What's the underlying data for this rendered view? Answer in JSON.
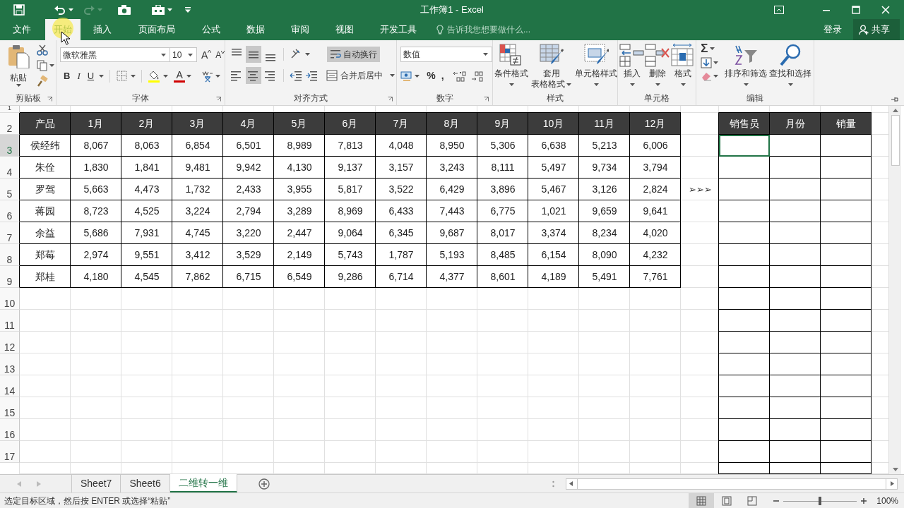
{
  "title_bar": {
    "title": "工作簿1 - Excel"
  },
  "menu_tabs": [
    {
      "label": "文件",
      "selected": false
    },
    {
      "label": "开始",
      "selected": true
    },
    {
      "label": "插入",
      "selected": false
    },
    {
      "label": "页面布局",
      "selected": false
    },
    {
      "label": "公式",
      "selected": false
    },
    {
      "label": "数据",
      "selected": false
    },
    {
      "label": "审阅",
      "selected": false
    },
    {
      "label": "视图",
      "selected": false
    },
    {
      "label": "开发工具",
      "selected": false
    }
  ],
  "tell_me": {
    "placeholder": "告诉我您想要做什么..."
  },
  "account": {
    "sign_in": "登录",
    "share": "共享"
  },
  "ribbon": {
    "clipboard": {
      "label": "剪贴板",
      "paste": "粘贴"
    },
    "font": {
      "label": "字体",
      "font_name": "微软雅黑",
      "font_size": "10",
      "grow": "A",
      "shrink": "A",
      "styles": [
        "B",
        "I",
        "U"
      ],
      "font_color": "A"
    },
    "alignment": {
      "label": "对齐方式",
      "vertical": [
        {
          "selected": false
        },
        {
          "selected": true
        },
        {
          "selected": false
        }
      ],
      "horizontal": [
        {
          "selected": false
        },
        {
          "selected": true
        },
        {
          "selected": false
        }
      ],
      "wrap_text": {
        "label": "自动换行",
        "selected": true
      },
      "merge": "合并后居中"
    },
    "number": {
      "label": "数字",
      "format": "数值",
      "symbols": [
        "%",
        ","
      ]
    },
    "styles": {
      "label": "样式",
      "buttons": [
        {
          "kind": "conditional",
          "lines": [
            "条件格式"
          ]
        },
        {
          "kind": "table",
          "lines": [
            "套用",
            "表格格式"
          ]
        },
        {
          "kind": "cell",
          "lines": [
            "单元格样式"
          ]
        }
      ]
    },
    "cells": {
      "label": "单元格",
      "buttons": [
        {
          "kind": "insert",
          "lines": [
            "插入"
          ]
        },
        {
          "kind": "delete",
          "lines": [
            "删除"
          ]
        },
        {
          "kind": "format",
          "lines": [
            "格式"
          ]
        }
      ]
    },
    "editing": {
      "label": "编辑",
      "autosum": "Σ",
      "buttons": [
        {
          "kind": "sort",
          "lines": [
            "排序和筛选"
          ]
        },
        {
          "kind": "find",
          "lines": [
            "查找和选择"
          ]
        }
      ]
    }
  },
  "sheet": {
    "row_headers": [
      {
        "label": "1",
        "selected": false
      },
      {
        "label": "2",
        "selected": false
      },
      {
        "label": "3",
        "selected": true
      },
      {
        "label": "4",
        "selected": false
      },
      {
        "label": "5",
        "selected": false
      },
      {
        "label": "6",
        "selected": false
      },
      {
        "label": "7",
        "selected": false
      },
      {
        "label": "8",
        "selected": false
      },
      {
        "label": "9",
        "selected": false
      },
      {
        "label": "10",
        "selected": false
      },
      {
        "label": "11",
        "selected": false
      },
      {
        "label": "12",
        "selected": false
      },
      {
        "label": "13",
        "selected": false
      },
      {
        "label": "14",
        "selected": false
      },
      {
        "label": "15",
        "selected": false
      },
      {
        "label": "16",
        "selected": false
      },
      {
        "label": "17",
        "selected": false
      }
    ],
    "data_table": {
      "columns": [
        "产品",
        "1月",
        "2月",
        "3月",
        "4月",
        "5月",
        "6月",
        "7月",
        "8月",
        "9月",
        "10月",
        "11月",
        "12月"
      ],
      "rows": [
        [
          "侯经纬",
          "8,067",
          "8,063",
          "6,854",
          "6,501",
          "8,989",
          "7,813",
          "4,048",
          "8,950",
          "5,306",
          "6,638",
          "5,213",
          "6,006"
        ],
        [
          "朱佺",
          "1,830",
          "1,841",
          "9,481",
          "9,942",
          "4,130",
          "9,137",
          "3,157",
          "3,243",
          "8,111",
          "5,497",
          "9,734",
          "3,794"
        ],
        [
          "罗驾",
          "5,663",
          "4,473",
          "1,732",
          "2,433",
          "3,955",
          "5,817",
          "3,522",
          "6,429",
          "3,896",
          "5,467",
          "3,126",
          "2,824"
        ],
        [
          "蒋园",
          "8,723",
          "4,525",
          "3,224",
          "2,794",
          "3,289",
          "8,969",
          "6,433",
          "7,443",
          "6,775",
          "1,021",
          "9,659",
          "9,641"
        ],
        [
          "余益",
          "5,686",
          "7,931",
          "4,745",
          "3,220",
          "2,447",
          "9,064",
          "6,345",
          "9,687",
          "8,017",
          "3,374",
          "8,234",
          "4,020"
        ],
        [
          "郑莓",
          "2,974",
          "9,551",
          "3,412",
          "3,529",
          "2,149",
          "5,743",
          "1,787",
          "5,193",
          "8,485",
          "6,154",
          "8,090",
          "4,232"
        ],
        [
          "郑桂",
          "4,180",
          "4,545",
          "7,862",
          "6,715",
          "6,549",
          "9,286",
          "6,714",
          "4,377",
          "8,601",
          "4,189",
          "5,491",
          "7,761"
        ]
      ]
    },
    "arrow_marker": "➢➢➢",
    "output_table": {
      "columns": [
        "销售员",
        "月份",
        "销量"
      ],
      "rows": [
        [
          {
            "selected": true
          },
          {
            "selected": false
          },
          {
            "selected": false
          }
        ],
        [
          {
            "selected": false
          },
          {
            "selected": false
          },
          {
            "selected": false
          }
        ],
        [
          {
            "selected": false
          },
          {
            "selected": false
          },
          {
            "selected": false
          }
        ],
        [
          {
            "selected": false
          },
          {
            "selected": false
          },
          {
            "selected": false
          }
        ],
        [
          {
            "selected": false
          },
          {
            "selected": false
          },
          {
            "selected": false
          }
        ],
        [
          {
            "selected": false
          },
          {
            "selected": false
          },
          {
            "selected": false
          }
        ],
        [
          {
            "selected": false
          },
          {
            "selected": false
          },
          {
            "selected": false
          }
        ],
        [
          {
            "selected": false
          },
          {
            "selected": false
          },
          {
            "selected": false
          }
        ],
        [
          {
            "selected": false
          },
          {
            "selected": false
          },
          {
            "selected": false
          }
        ],
        [
          {
            "selected": false
          },
          {
            "selected": false
          },
          {
            "selected": false
          }
        ],
        [
          {
            "selected": false
          },
          {
            "selected": false
          },
          {
            "selected": false
          }
        ],
        [
          {
            "selected": false
          },
          {
            "selected": false
          },
          {
            "selected": false
          }
        ],
        [
          {
            "selected": false
          },
          {
            "selected": false
          },
          {
            "selected": false
          }
        ],
        [
          {
            "selected": false
          },
          {
            "selected": false
          },
          {
            "selected": false
          }
        ],
        [
          {
            "selected": false
          },
          {
            "selected": false
          },
          {
            "selected": false
          }
        ],
        [
          {
            "selected": false
          },
          {
            "selected": false
          },
          {
            "selected": false
          }
        ]
      ]
    }
  },
  "sheet_tabs": [
    {
      "label": "Sheet7",
      "selected": false
    },
    {
      "label": "Sheet6",
      "selected": false
    },
    {
      "label": "二维转一维",
      "selected": true
    }
  ],
  "status_bar": {
    "message": "选定目标区域，然后按 ENTER 或选择“粘贴”",
    "views": [
      {
        "kind": "normal",
        "selected": true
      },
      {
        "kind": "page_layout",
        "selected": false
      },
      {
        "kind": "page_break",
        "selected": false
      }
    ],
    "zoom_slider": {
      "level": 0.5
    },
    "zoom": "100%"
  }
}
